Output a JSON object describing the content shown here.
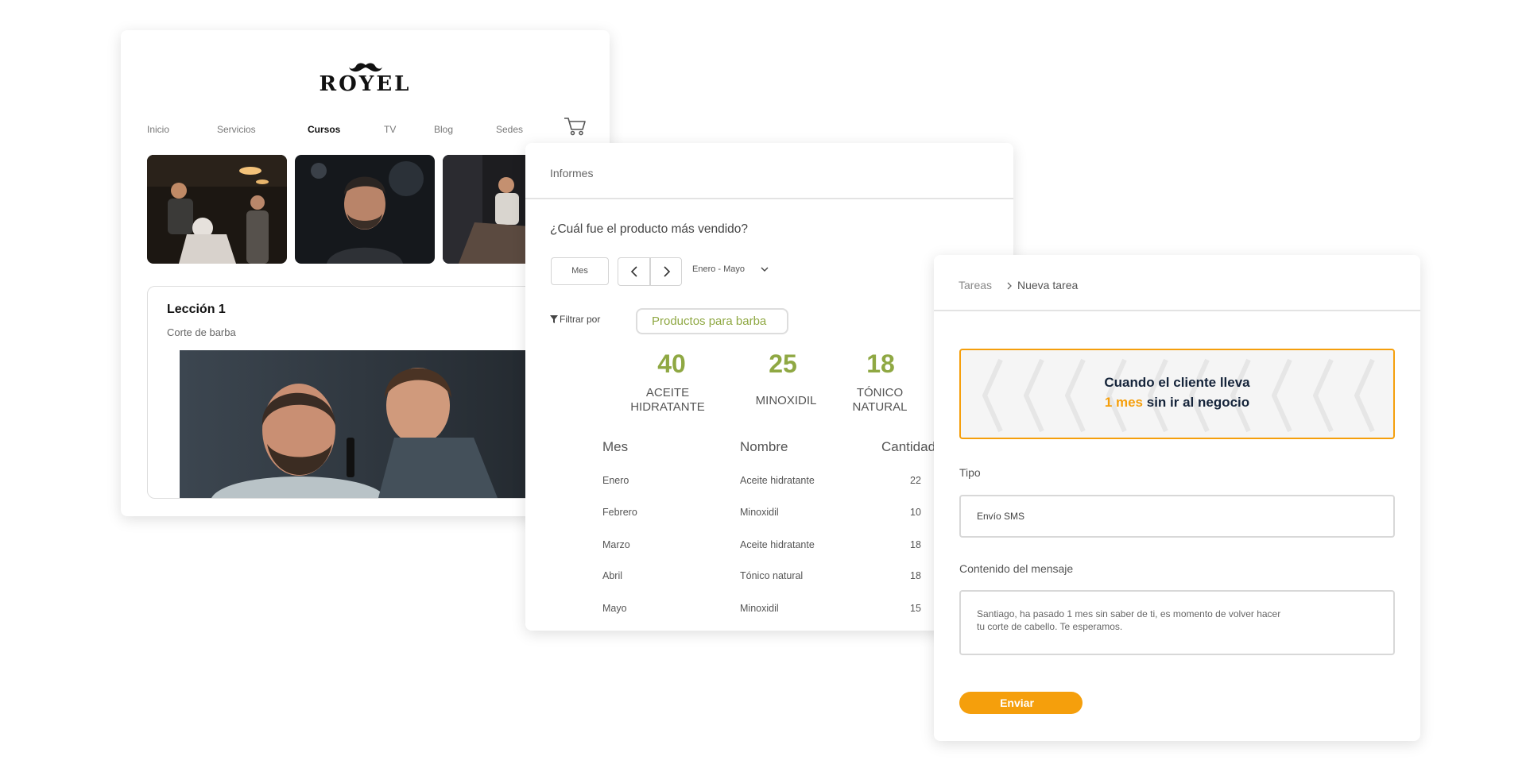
{
  "website": {
    "brand": "ROYEL",
    "nav": [
      {
        "label": "Inicio"
      },
      {
        "label": "Servicios"
      },
      {
        "label": "Cursos",
        "active": true
      },
      {
        "label": "TV"
      },
      {
        "label": "Blog"
      },
      {
        "label": "Sedes"
      }
    ],
    "cart_icon": "cart-icon",
    "lesson": {
      "title": "Lección 1",
      "subtitle": "Corte de barba"
    }
  },
  "report": {
    "title": "Informes",
    "question": "¿Cuál fue el producto más vendido?",
    "period_button": "Mes",
    "range": "Enero - Mayo",
    "filter_label": "Filtrar por",
    "filter_value": "Productos para barba",
    "accent_color": "#8fa843",
    "stats": [
      {
        "value": "40",
        "label_line1": "ACEITE",
        "label_line2": "HIDRATANTE"
      },
      {
        "value": "25",
        "label_line1": "MINOXIDIL",
        "label_line2": ""
      },
      {
        "value": "18",
        "label_line1": "TÓNICO",
        "label_line2": "NATURAL"
      }
    ],
    "table": {
      "headers": [
        "Mes",
        "Nombre",
        "Cantidad"
      ],
      "rows": [
        [
          "Enero",
          "Aceite hidratante",
          "22"
        ],
        [
          "Febrero",
          "Minoxidil",
          "10"
        ],
        [
          "Marzo",
          "Aceite hidratante",
          "18"
        ],
        [
          "Abril",
          "Tónico natural",
          "18"
        ],
        [
          "Mayo",
          "Minoxidil",
          "15"
        ]
      ]
    }
  },
  "tasks": {
    "breadcrumb_root": "Tareas",
    "breadcrumb_current": "Nueva tarea",
    "banner_line1": "Cuando el cliente lleva",
    "banner_highlight": "1 mes",
    "banner_line2_rest": "sin ir al negocio",
    "accent_color": "#f59f0c",
    "type_label": "Tipo",
    "type_value": "Envío SMS",
    "message_label": "Contenido del mensaje",
    "message_line1": "Santiago, ha pasado 1 mes sin saber de ti, es momento de volver hacer",
    "message_line2": "tu corte de cabello. Te esperamos.",
    "send_button": "Enviar"
  }
}
